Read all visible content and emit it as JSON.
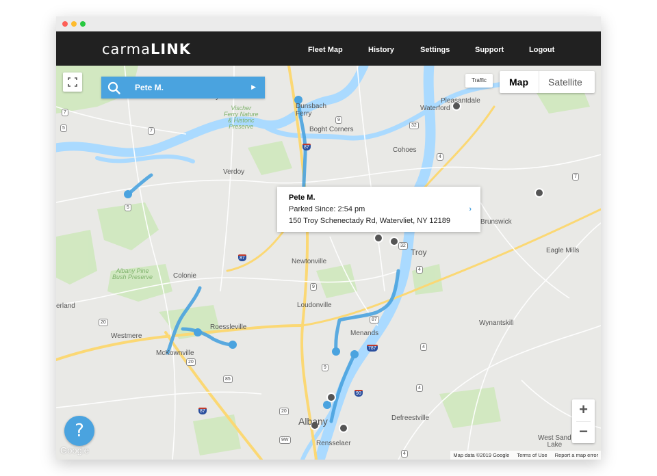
{
  "brand": {
    "logo_light": "carma",
    "logo_bold": "LINK"
  },
  "nav": {
    "items": [
      "Fleet Map",
      "History",
      "Settings",
      "Support",
      "Logout"
    ]
  },
  "search": {
    "name": "Pete M."
  },
  "map_type": {
    "map_label": "Map",
    "satellite_label": "Satellite",
    "selected": "Map"
  },
  "traffic_label": "Traffic",
  "info_window": {
    "driver": "Pete M.",
    "parked": "Parked Since: 2:54 pm",
    "address": "150 Troy Schenectady Rd, Watervliet, NY 12189"
  },
  "places": {
    "glenville": "Visscher Ferry",
    "preserve": "Vischer\nFerry Nature\n& Historic\nPreserve",
    "ferry": "Dunsbach\nFerry",
    "boght": "Boght Corners",
    "waterford": "Waterford",
    "pleasantdale": "Pleasantdale",
    "cohoes": "Cohoes",
    "verdoy": "Verdoy",
    "newtonville": "Newtonville",
    "troy": "Troy",
    "eagle_mills": "Eagle Mills",
    "brunswick": "Brunswick",
    "pine_bush": "Albany Pine\nBush Preserve",
    "colonie": "Colonie",
    "loudonville": "Loudonville",
    "roessleville": "Roessleville",
    "westmere": "Westmere",
    "mckownville": "McKownville",
    "menands": "Menands",
    "wynantskill": "Wynantskill",
    "albany": "Albany",
    "defreestville": "Defreestville",
    "rensselaer": "Rensselaer",
    "west_sand_lake": "West Sand\nLake",
    "guilderland": "erland"
  },
  "zoom": {
    "in": "+",
    "out": "−"
  },
  "help": "?",
  "google": "Google",
  "attribution": [
    "Map data ©2019 Google",
    "Terms of Use",
    "Report a map error"
  ],
  "colors": {
    "route": "#4aa3df",
    "navbar": "#212121",
    "water": "#aadaff",
    "park": "#c8e6b0"
  },
  "icons": [
    "search-icon",
    "fullscreen-icon",
    "play-arrow-icon",
    "chevron-right-icon",
    "help-icon"
  ]
}
